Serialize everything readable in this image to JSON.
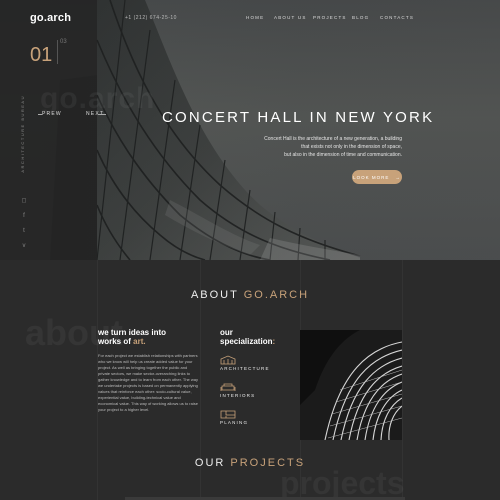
{
  "brand": {
    "logo": "go.arch"
  },
  "slider": {
    "current": "01",
    "total": "03",
    "vertical_label": "ARCHITECTURE BUREAU",
    "bg_word": "go.arch",
    "prev_label": "PREW",
    "next_label": "NEXT"
  },
  "header": {
    "phone": "+1 (212) 674-25-10",
    "nav": [
      "HOME",
      "ABOUT US",
      "PROJECTS",
      "BLOG",
      "CONTACTS"
    ]
  },
  "hero": {
    "title": "CONCERT HALL IN NEW YORK",
    "desc_1": "Concert Hall is the architecture of a new generation, a building",
    "desc_2": "that exists not only in the dimension of space,",
    "desc_3": "but also in the dimension of time and communication.",
    "button_label": "LOOK MORE",
    "button_arrow": "→"
  },
  "social": [
    "instagram-icon",
    "facebook-icon",
    "twitter-icon",
    "vk-icon"
  ],
  "about": {
    "title_pre": "ABOUT ",
    "title_accent": "GO.ARCH",
    "bg_word": "about",
    "ideas_line1": "we turn ideas into",
    "ideas_line2_pre": "works of ",
    "ideas_line2_accent": "art.",
    "paragraph": "For each project we establish relationships with partners who we know will help us create added value for your project. As well as bringing together the public and private sectors, we make sector-overarching links to gather knowledge and to learn from each other. The way we undertake projects is based on permanently applying values that reinforce each other: socio-cultural value, experiential value, building-technical value and economical value. This way of working allows us to raise your project to a higher level.",
    "spec_line1": "our",
    "spec_line2": "specialization",
    "spec_colon": ":",
    "specializations": [
      "ARCHITECTURE",
      "INTERIORS",
      "PLANING"
    ]
  },
  "projects": {
    "title_pre": "OUR ",
    "title_accent": "PROJECTS",
    "bg_word": "projects"
  },
  "colors": {
    "accent": "#c8a27a",
    "panel": "#242424",
    "background": "#2b2b2b"
  }
}
